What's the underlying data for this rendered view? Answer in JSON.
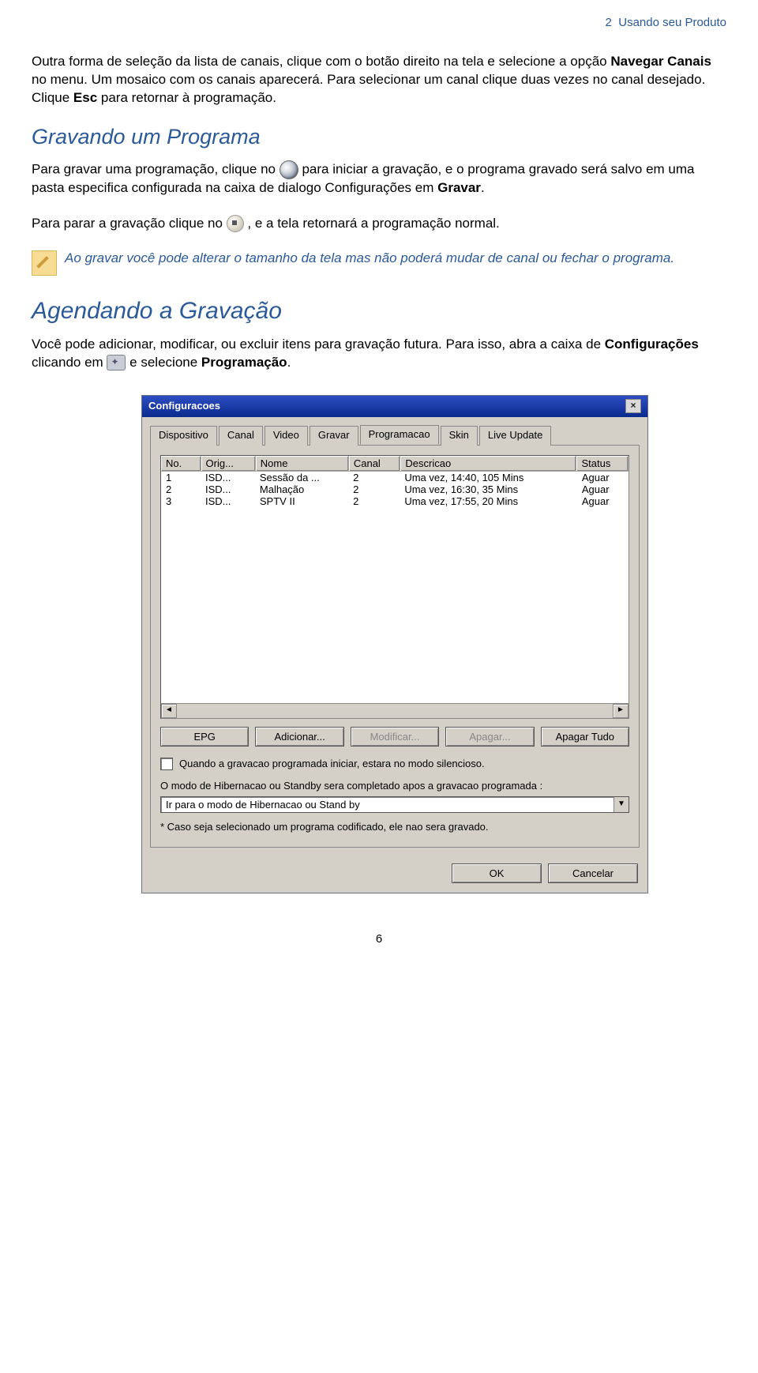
{
  "header": {
    "section_num": "2",
    "section_title": "Usando seu Produto"
  },
  "intro": {
    "p1_a": "Outra forma de seleção da lista de canais, clique com o botão direito na tela e selecione a opção ",
    "p1_b": "Navegar Canais",
    "p1_c": " no menu. Um mosaico com os canais aparecerá. Para selecionar um canal clique duas vezes no canal desejado. Clique ",
    "p1_d": "Esc",
    "p1_e": " para retornar à programação."
  },
  "gravando": {
    "title": "Gravando um Programa",
    "p1_a": "Para gravar uma programação, clique no ",
    "p1_b": " para iniciar a gravação, e o programa gravado será salvo em uma pasta especifica configurada na caixa de dialogo Configurações em ",
    "p1_c": "Gravar",
    "p1_d": ".",
    "p2_a": "Para parar a gravação clique no ",
    "p2_b": " , e a tela retornará a programação normal.",
    "note": "Ao gravar você pode alterar o tamanho da tela mas não poderá mudar de canal ou fechar o programa."
  },
  "agendando": {
    "title": "Agendando a Gravação",
    "p1_a": "Você pode adicionar, modificar, ou excluir itens para gravação futura. Para isso, abra a caixa de ",
    "p1_b": "Configurações",
    "p1_c": " clicando em ",
    "p1_d": " e selecione ",
    "p1_e": "Programação",
    "p1_f": "."
  },
  "dialog": {
    "title": "Configuracoes",
    "tabs": [
      "Dispositivo",
      "Canal",
      "Video",
      "Gravar",
      "Programacao",
      "Skin",
      "Live Update"
    ],
    "active_tab": 4,
    "columns": [
      "No.",
      "Orig...",
      "Nome",
      "Canal",
      "Descricao",
      "Status"
    ],
    "rows": [
      {
        "no": "1",
        "orig": "ISD...",
        "nome": "Sessão da ...",
        "canal": "2",
        "desc": "Uma vez, 14:40, 105 Mins",
        "stat": "Aguar"
      },
      {
        "no": "2",
        "orig": "ISD...",
        "nome": "Malhação",
        "canal": "2",
        "desc": "Uma vez, 16:30, 35 Mins",
        "stat": "Aguar"
      },
      {
        "no": "3",
        "orig": "ISD...",
        "nome": "SPTV II",
        "canal": "2",
        "desc": "Uma vez, 17:55, 20 Mins",
        "stat": "Aguar"
      }
    ],
    "buttons": {
      "epg": "EPG",
      "add": "Adicionar...",
      "mod": "Modificar...",
      "del": "Apagar...",
      "clear": "Apagar Tudo"
    },
    "checkbox_label": "Quando a gravacao programada iniciar, estara no modo silencioso.",
    "info_text": "O modo de Hibernacao ou Standby sera completado apos a gravacao programada :",
    "dropdown_value": "Ir para o modo de Hibernacao ou Stand by",
    "footer_note": "* Caso seja selecionado um programa codificado, ele nao sera gravado.",
    "ok": "OK",
    "cancel": "Cancelar"
  },
  "page_number": "6"
}
